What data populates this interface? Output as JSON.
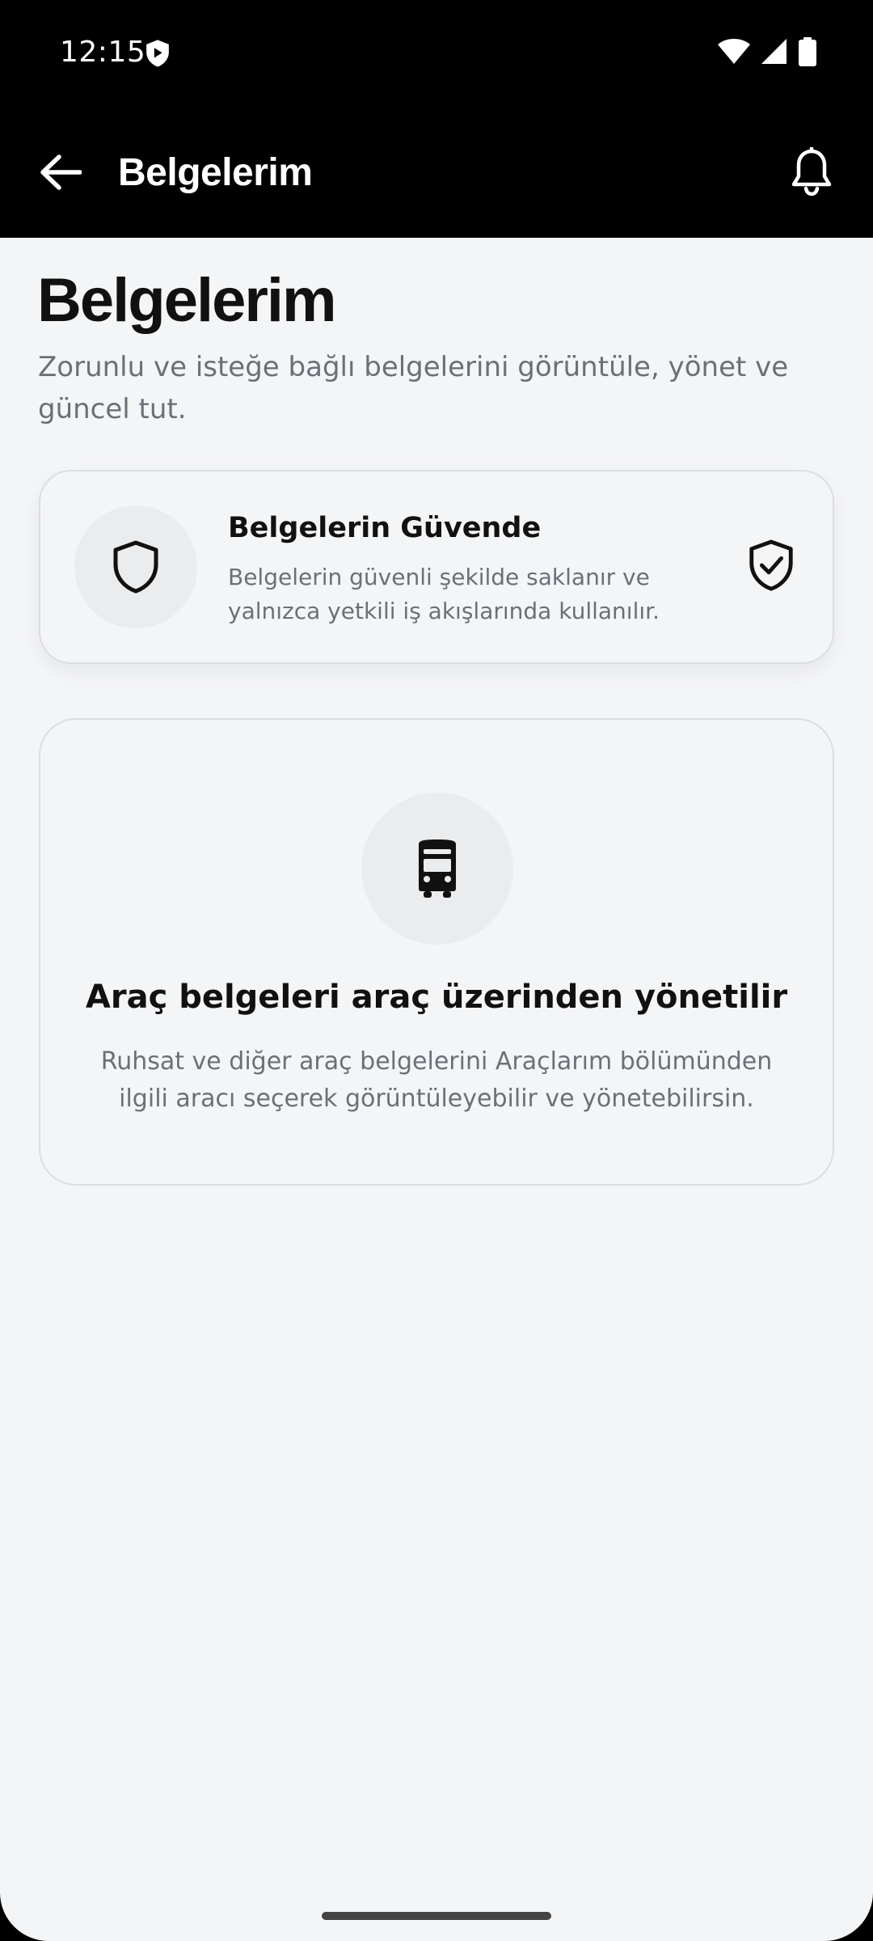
{
  "status_bar": {
    "time": "12:15",
    "icons": [
      "shield-icon",
      "wifi-icon",
      "signal-icon",
      "battery-icon"
    ]
  },
  "app_bar": {
    "title": "Belgelerim",
    "back_icon": "arrow-left-icon",
    "notification_icon": "bell-icon"
  },
  "header": {
    "title": "Belgelerim",
    "subtitle": "Zorunlu ve isteğe bağlı belgelerini görüntüle, yönet ve güncel tut."
  },
  "security_card": {
    "title": "Belgelerin Güvende",
    "description": "Belgelerin güvenli şekilde saklanır ve yalnızca yetkili iş akışlarında kullanılır.",
    "icon": "shield-icon",
    "badge_icon": "shield-check-icon"
  },
  "vehicle_card": {
    "icon": "bus-icon",
    "title": "Araç belgeleri araç üzerinden yönetilir",
    "description": "Ruhsat ve diğer araç belgelerini Araçlarım bölümünden ilgili aracı seçerek görüntüleyebilir ve yönetebilirsin."
  }
}
